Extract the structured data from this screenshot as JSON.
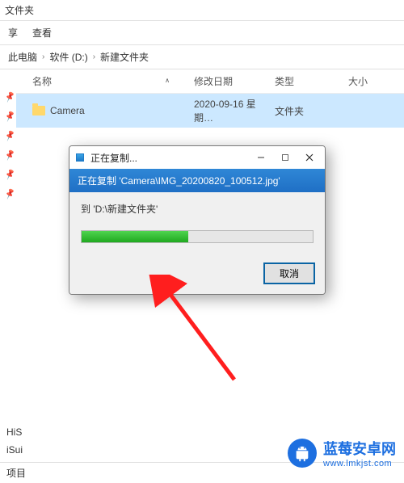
{
  "window": {
    "title_frag": "文件夹"
  },
  "menu": {
    "share": "享",
    "view": "查看"
  },
  "breadcrumb": {
    "root": "此电脑",
    "drive": "软件 (D:)",
    "folder": "新建文件夹"
  },
  "columns": {
    "name": "名称",
    "modified": "修改日期",
    "type": "类型",
    "size": "大小"
  },
  "rows": [
    {
      "name": "Camera",
      "modified": "2020-09-16 星期…",
      "type": "文件夹",
      "size": ""
    }
  ],
  "bottom": {
    "items": [
      "HiS",
      "iSui"
    ],
    "status": "项目"
  },
  "dialog": {
    "title": "正在复制...",
    "banner": "正在复制 'Camera\\IMG_20200820_100512.jpg'",
    "dest": "到 'D:\\新建文件夹'",
    "progress_pct": 46,
    "cancel": "取消"
  },
  "watermark": {
    "line1": "蓝莓安卓网",
    "line2": "www.lmkjst.com"
  }
}
